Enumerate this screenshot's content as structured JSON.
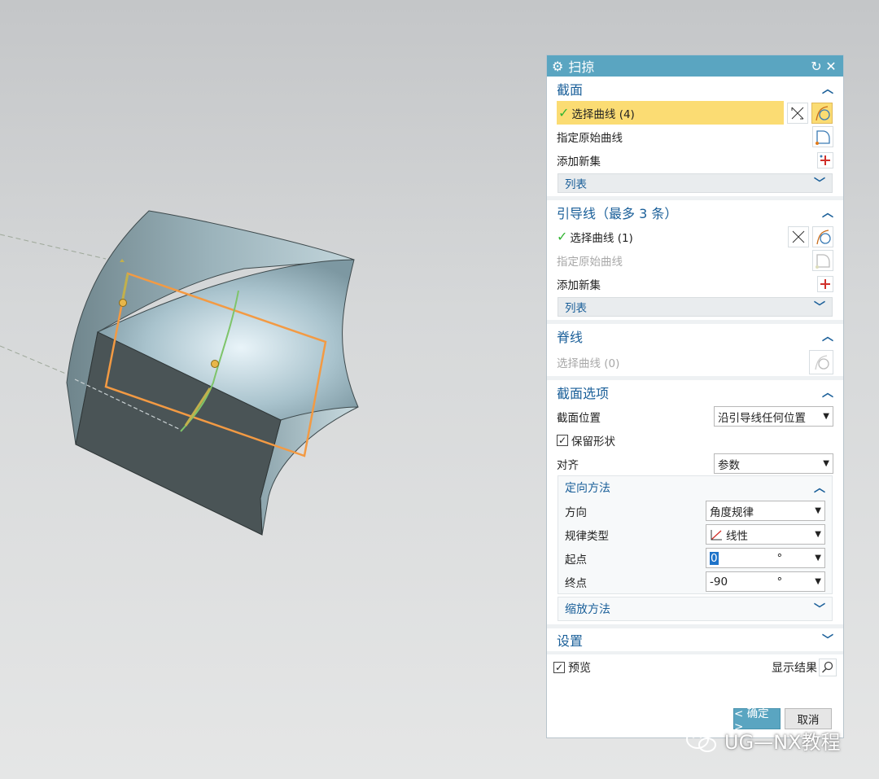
{
  "dialog": {
    "title": "扫掠",
    "section": {
      "title": "截面",
      "select_curve": "选择曲线 (4)",
      "specify_origin": "指定原始曲线",
      "add_new_set": "添加新集",
      "list": "列表"
    },
    "guide": {
      "title": "引导线（最多 3 条）",
      "select_curve": "选择曲线 (1)",
      "specify_origin": "指定原始曲线",
      "add_new_set": "添加新集",
      "list": "列表"
    },
    "spine": {
      "title": "脊线",
      "select_curve": "选择曲线 (0)"
    },
    "section_options": {
      "title": "截面选项",
      "section_position_label": "截面位置",
      "section_position_value": "沿引导线任何位置",
      "preserve_shape": "保留形状",
      "align_label": "对齐",
      "align_value": "参数",
      "orientation": {
        "title": "定向方法",
        "direction_label": "方向",
        "direction_value": "角度规律",
        "law_type_label": "规律类型",
        "law_type_value": "线性",
        "start_label": "起点",
        "start_value": "0",
        "start_unit": "°",
        "end_label": "终点",
        "end_value": "-90",
        "end_unit": "°"
      },
      "scaling": {
        "title": "缩放方法"
      }
    },
    "settings": {
      "title": "设置"
    },
    "preview": "预览",
    "show_result": "显示结果",
    "ok": "< 确定 >",
    "cancel": "取消"
  },
  "watermark": "UG—NX教程",
  "colors": {
    "accent": "#5aa5c1",
    "highlight": "#fbdc73",
    "heading": "#1a5f99",
    "plane": "#f39a43",
    "guide_curve": "#7ec46a"
  }
}
